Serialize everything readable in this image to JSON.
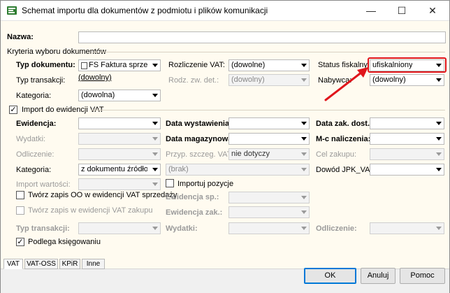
{
  "window": {
    "title": "Schemat importu dla dokumentów z podmiotu i plików komunikacji"
  },
  "name_label": "Nazwa:",
  "name_value": "",
  "criteria": {
    "group_label": "Kryteria wyboru dokumentów",
    "doc_type_label": "Typ dokumentu:",
    "doc_type_value": "FS Faktura sprzedaży",
    "vat_settlement_label": "Rozliczenie VAT:",
    "vat_settlement_value": "(dowolne)",
    "fiscal_status_label": "Status fiskalny:",
    "fiscal_status_value": "ufiskalniony",
    "transaction_type_label": "Typ transakcji:",
    "transaction_type_value": "(dowolny)",
    "rodz_label": "Rodz. zw. det.:",
    "rodz_value": "(dowolny)",
    "buyer_label": "Nabywca:",
    "buyer_value": "(dowolny)",
    "category_label": "Kategoria:",
    "category_value": "(dowolna)"
  },
  "vat_import": {
    "checkbox_label": "Import do ewidencji VAT",
    "checked": true,
    "register_label": "Ewidencja:",
    "register_value": "",
    "issue_date_label": "Data wystawienia:",
    "issue_date_value": "",
    "purchase_date_label": "Data zak. dost.:",
    "purchase_date_value": "",
    "expenses_label": "Wydatki:",
    "expenses_value": "",
    "warehouse_date_label": "Data magazynowa:",
    "warehouse_date_value": "",
    "accrual_month_label": "M-c naliczenia:",
    "accrual_month_value": "",
    "deduction_label": "Odliczenie:",
    "deduction_value": "",
    "special_vat_label": "Przyp. szczeg. VAT:",
    "special_vat_value": "nie dotyczy",
    "purchase_goal_label": "Cel zakupu:",
    "purchase_goal_value": "",
    "category2_label": "Kategoria:",
    "category2_value": "z dokumentu źródłowego",
    "brak_value": "(brak)",
    "jpk_label": "Dowód JPK_VAT:",
    "jpk_value": "",
    "import_value_label": "Import wartości:",
    "import_value_value": "",
    "import_positions_label": "Importuj pozycje",
    "import_positions_checked": false,
    "create_oo_sales_label": "Twórz zapis OO w ewidencji VAT sprzedaży",
    "create_oo_sales_checked": false,
    "sp_register_label": "Ewidencja sp.:",
    "sp_register_value": "",
    "create_purchase_label": "Twórz zapis w ewidencji VAT zakupu",
    "create_purchase_checked": false,
    "zak_register_label": "Ewidencja zak.:",
    "zak_register_value": "",
    "tx_type_label": "Typ transakcji:",
    "tx_type_value": "",
    "expenses2_label": "Wydatki:",
    "expenses2_value": "",
    "deduction2_label": "Odliczenie:",
    "deduction2_value": "",
    "bookkeeping_label": "Podlega księgowaniu",
    "bookkeeping_checked": true
  },
  "tabs": [
    "VAT",
    "VAT-OSS",
    "KPiR",
    "Inne"
  ],
  "buttons": {
    "ok": "OK",
    "cancel": "Anuluj",
    "help": "Pomoc"
  },
  "colors": {
    "highlight": "#e0151b",
    "background": "#fffbf0"
  }
}
